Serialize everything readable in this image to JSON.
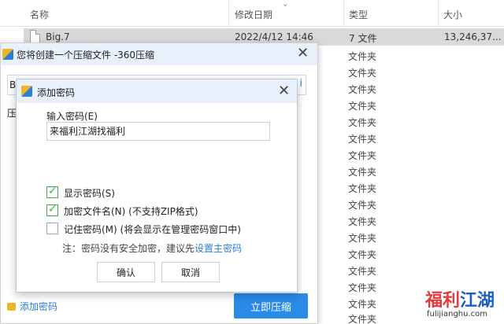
{
  "explorer": {
    "columns": {
      "name": "名称",
      "date": "修改日期",
      "type": "类型",
      "size": "大小"
    },
    "selected_file": {
      "name": "Big.7",
      "date": "2022/4/12 14:46",
      "type": "7 文件",
      "size": "13,246,37..."
    },
    "folder_type": "文件夹"
  },
  "main_dialog": {
    "title": "您将创建一个压缩文件 -360压缩",
    "path_prefix": "B",
    "path_suffix": "i",
    "compress_label": "压",
    "add_password_link": "添加密码",
    "start_button": "立即压缩"
  },
  "password_dialog": {
    "title": "添加密码",
    "input_label": "输入密码(E)",
    "password_value": "来福利江湖找福利",
    "show_password": {
      "label": "显示密码(S)",
      "checked": true
    },
    "encrypt_filenames": {
      "label": "加密文件名(N) (不支持ZIP格式)",
      "checked": true
    },
    "remember_password": {
      "label": "记住密码(M) (将会显示在管理密码窗口中)",
      "checked": false
    },
    "note_text": "注：密码没有安全加密，建议先",
    "note_link": "设置主密码",
    "ok_button": "确认",
    "cancel_button": "取消"
  },
  "watermark": {
    "part1": "福利",
    "part2": "江湖",
    "sub": "fulijianghu.com"
  },
  "colors": {
    "accent": "#2a8ae8",
    "link": "#2a7fd4",
    "check": "#3fae49",
    "titlebar": "#e8f1fb"
  }
}
